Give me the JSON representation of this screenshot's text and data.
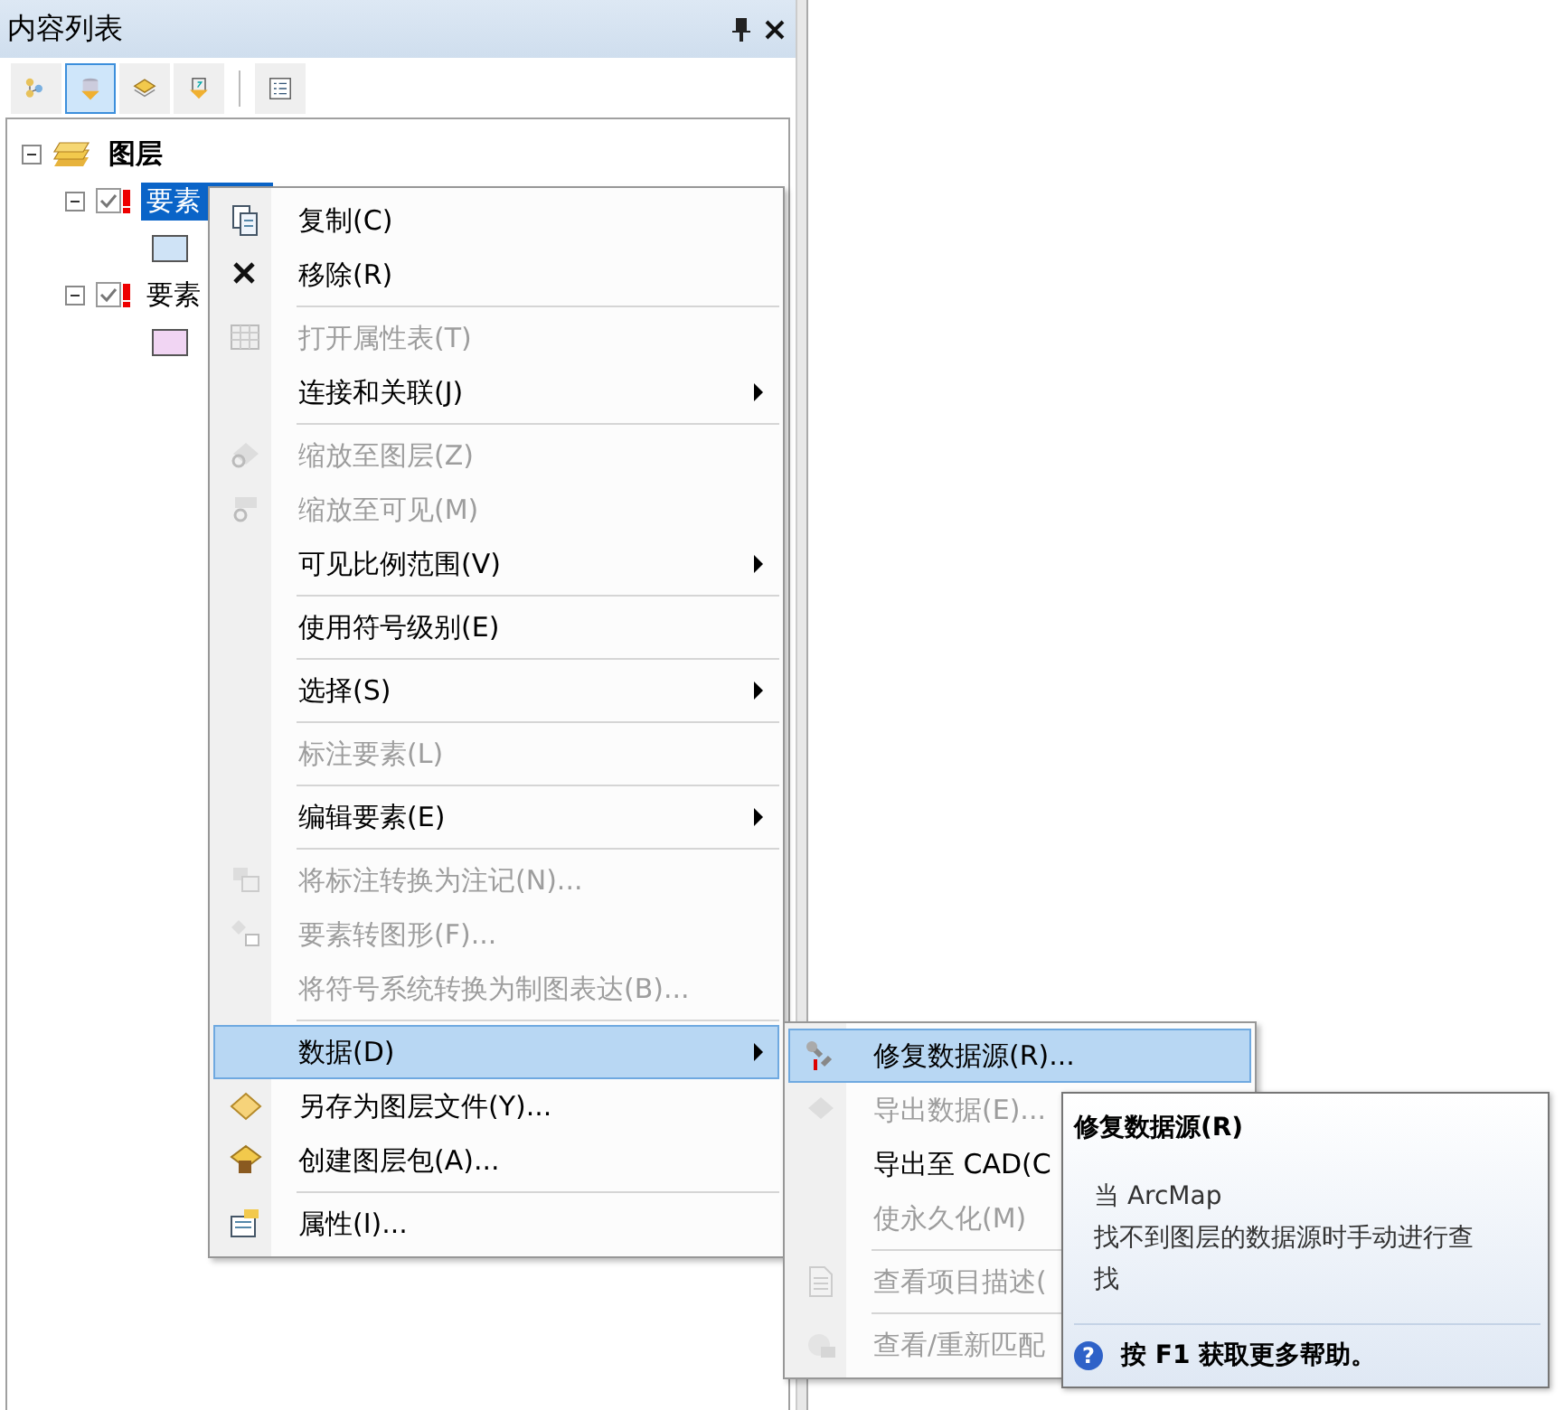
{
  "panel": {
    "title": "内容列表"
  },
  "toolbar": [
    {
      "selected": false
    },
    {
      "selected": true
    },
    {
      "selected": false
    },
    {
      "selected": false
    },
    {
      "selected": false
    }
  ],
  "tree": {
    "label": "图层",
    "expanded": true,
    "children": [
      {
        "label": "要素",
        "checked": true,
        "broken": true,
        "selected": true,
        "expanded": true,
        "color": "#cfe3f6"
      },
      {
        "label": "要素",
        "checked": true,
        "broken": true,
        "selected": false,
        "expanded": true,
        "color": "#f1d5f3"
      }
    ]
  },
  "context_menu": [
    {
      "kind": "item",
      "label": "复制(C)",
      "disabled": false,
      "submenu": false,
      "selected": false
    },
    {
      "kind": "item",
      "label": "移除(R)",
      "disabled": false,
      "submenu": false,
      "selected": false
    },
    {
      "kind": "separator"
    },
    {
      "kind": "item",
      "label": "打开属性表(T)",
      "disabled": true,
      "submenu": false,
      "selected": false
    },
    {
      "kind": "item",
      "label": "连接和关联(J)",
      "disabled": false,
      "submenu": true,
      "selected": false
    },
    {
      "kind": "separator"
    },
    {
      "kind": "item",
      "label": "缩放至图层(Z)",
      "disabled": true,
      "submenu": false,
      "selected": false
    },
    {
      "kind": "item",
      "label": "缩放至可见(M)",
      "disabled": true,
      "submenu": false,
      "selected": false
    },
    {
      "kind": "item",
      "label": "可见比例范围(V)",
      "disabled": false,
      "submenu": true,
      "selected": false
    },
    {
      "kind": "separator"
    },
    {
      "kind": "item",
      "label": "使用符号级别(E)",
      "disabled": false,
      "submenu": false,
      "selected": false
    },
    {
      "kind": "separator"
    },
    {
      "kind": "item",
      "label": "选择(S)",
      "disabled": false,
      "submenu": true,
      "selected": false
    },
    {
      "kind": "separator"
    },
    {
      "kind": "item",
      "label": "标注要素(L)",
      "disabled": true,
      "submenu": false,
      "selected": false
    },
    {
      "kind": "separator"
    },
    {
      "kind": "item",
      "label": "编辑要素(E)",
      "disabled": false,
      "submenu": true,
      "selected": false
    },
    {
      "kind": "separator"
    },
    {
      "kind": "item",
      "label": "将标注转换为注记(N)...",
      "disabled": true,
      "submenu": false,
      "selected": false
    },
    {
      "kind": "item",
      "label": "要素转图形(F)...",
      "disabled": true,
      "submenu": false,
      "selected": false
    },
    {
      "kind": "item",
      "label": "将符号系统转换为制图表达(B)...",
      "disabled": true,
      "submenu": false,
      "selected": false
    },
    {
      "kind": "separator"
    },
    {
      "kind": "item",
      "label": "数据(D)",
      "disabled": false,
      "submenu": true,
      "selected": true
    },
    {
      "kind": "item",
      "label": "另存为图层文件(Y)...",
      "disabled": false,
      "submenu": false,
      "selected": false
    },
    {
      "kind": "item",
      "label": "创建图层包(A)...",
      "disabled": false,
      "submenu": false,
      "selected": false
    },
    {
      "kind": "separator"
    },
    {
      "kind": "item",
      "label": "属性(I)...",
      "disabled": false,
      "submenu": false,
      "selected": false
    }
  ],
  "submenu": [
    {
      "kind": "item",
      "label": "修复数据源(R)...",
      "disabled": false,
      "selected": true
    },
    {
      "kind": "item",
      "label": "导出数据(E)...",
      "disabled": true,
      "selected": false
    },
    {
      "kind": "item",
      "label": "导出至 CAD(C",
      "disabled": false,
      "selected": false
    },
    {
      "kind": "item",
      "label": "使永久化(M)",
      "disabled": true,
      "selected": false
    },
    {
      "kind": "separator"
    },
    {
      "kind": "item",
      "label": "查看项目描述(",
      "disabled": true,
      "selected": false
    },
    {
      "kind": "separator"
    },
    {
      "kind": "item",
      "label": "查看/重新匹配",
      "disabled": true,
      "selected": false
    }
  ],
  "tooltip": {
    "title": "修复数据源(R)",
    "lines": [
      "当 ArcMap",
      "找不到图层的数据源时手动进行查找"
    ],
    "help_glyph": "?",
    "help": "按 F1 获取更多帮助。"
  }
}
